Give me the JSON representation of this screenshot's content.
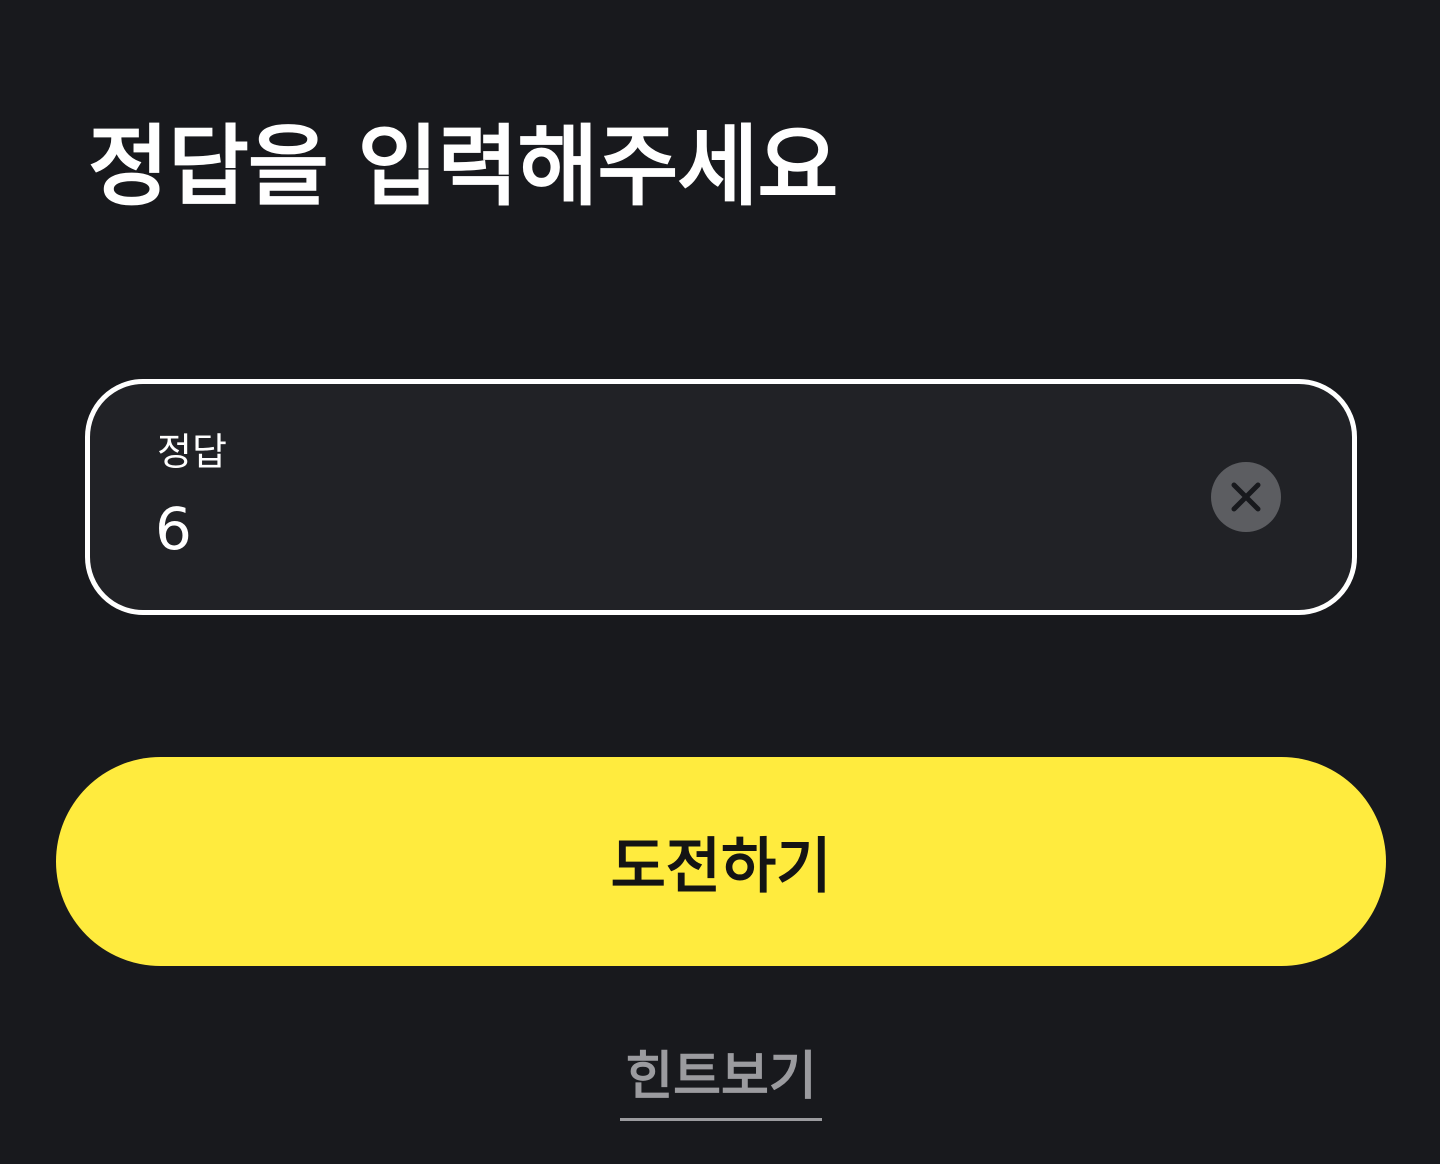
{
  "page": {
    "title": "정답을 입력해주세요"
  },
  "answer_field": {
    "label": "정답",
    "value": "6",
    "clear_icon": "close-icon"
  },
  "actions": {
    "submit_label": "도전하기",
    "hint_label": "힌트보기"
  },
  "colors": {
    "background": "#18191d",
    "field_background": "#212226",
    "field_border": "#ffffff",
    "accent": "#ffeb3e",
    "hint_text": "#9b9b9f"
  }
}
